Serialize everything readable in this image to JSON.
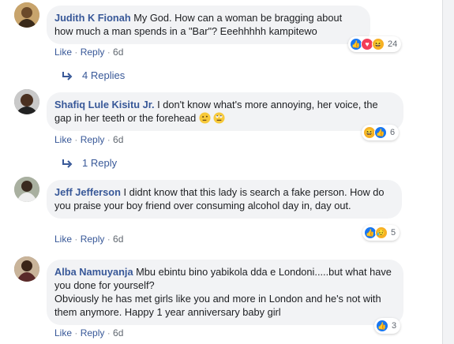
{
  "comments": [
    {
      "author": "Judith K Fionah",
      "text": " My God. How can a woman be bragging about how much a man spends in a \"Bar\"? Eeehhhhh kampitewo",
      "like": "Like",
      "reply": "Reply",
      "time": "6d",
      "reaction_count": "24",
      "replies_label": "4 Replies"
    },
    {
      "author": "Shafiq Lule Kisitu Jr.",
      "text": " I don't know what's more annoying, her voice, the gap in her teeth or the forehead",
      "like": "Like",
      "reply": "Reply",
      "time": "6d",
      "reaction_count": "6",
      "replies_label": "1 Reply"
    },
    {
      "author": "Jeff Jefferson",
      "text": " I didnt know that this lady is search a fake person. How do you praise your boy friend over consuming alcohol day in, day out.",
      "like": "Like",
      "reply": "Reply",
      "time": "6d",
      "reaction_count": "5"
    },
    {
      "author": "Alba Namuyanja",
      "text_line1": " Mbu ebintu bino yabikola dda e Londoni.....but what have you done for yourself?",
      "text_line2": "Obviously he has met girls like you and more in London and he's not with them anymore. Happy 1 year anniversary baby girl",
      "like": "Like",
      "reply": "Reply",
      "time": "6d",
      "reaction_count": "3"
    }
  ],
  "separator": " · "
}
